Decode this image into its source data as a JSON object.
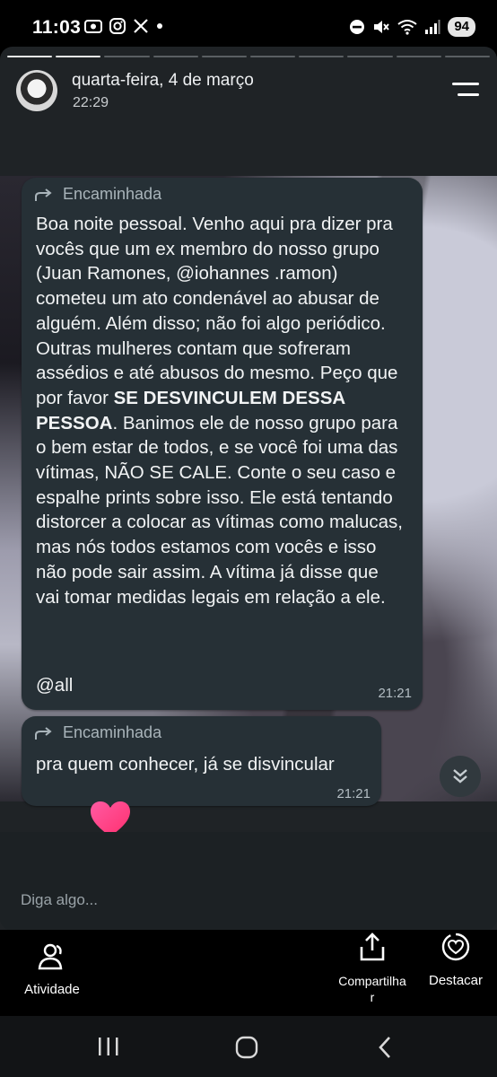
{
  "status_bar": {
    "time": "11:03",
    "battery": "94",
    "left_icons": [
      "screenshot-icon",
      "instagram-icon",
      "x-icon",
      "dot-icon"
    ],
    "right_icons": [
      "dnd-icon",
      "mute-icon",
      "wifi-icon",
      "signal-icon"
    ]
  },
  "story": {
    "progress_total": 10,
    "progress_filled": 2,
    "header": {
      "date": "quarta-feira, 4 de março",
      "time": "22:29"
    },
    "messages": [
      {
        "forward_label": "Encaminhada",
        "text_before": "Boa noite pessoal. Venho aqui pra dizer pra vocês que um ex membro do nosso grupo (Juan Ramones, @iohannes .ramon) cometeu um ato condenável ao abusar de alguém. Além disso; não foi algo periódico. Outras mulheres contam que sofreram assédios e até abusos do mesmo. Peço que por favor ",
        "text_bold": "SE DESVINCULEM DESSA PESSOA",
        "text_after": ". Banimos ele de nosso grupo para o bem estar de todos, e se você foi uma das vítimas, NÃO SE CALE. Conte o seu caso e espalhe prints sobre isso. Ele está tentando distorcer a colocar as vítimas como malucas, mas nós todos estamos com vocês e isso não pode sair assim. A vítima já disse que vai tomar medidas legais em relação a ele.",
        "mention": "@all",
        "time": "21:21"
      },
      {
        "forward_label": "Encaminhada",
        "text": "pra quem conhecer, já se disvincular",
        "time": "21:21"
      }
    ],
    "reply_placeholder": "Diga algo..."
  },
  "actions": {
    "activity_label": "Atividade",
    "share_label": "Compartilha\nr",
    "highlight_label": "Destacar"
  },
  "colors": {
    "bubble": "#263036",
    "heart": "#ff3d8b",
    "background": "#000000"
  }
}
